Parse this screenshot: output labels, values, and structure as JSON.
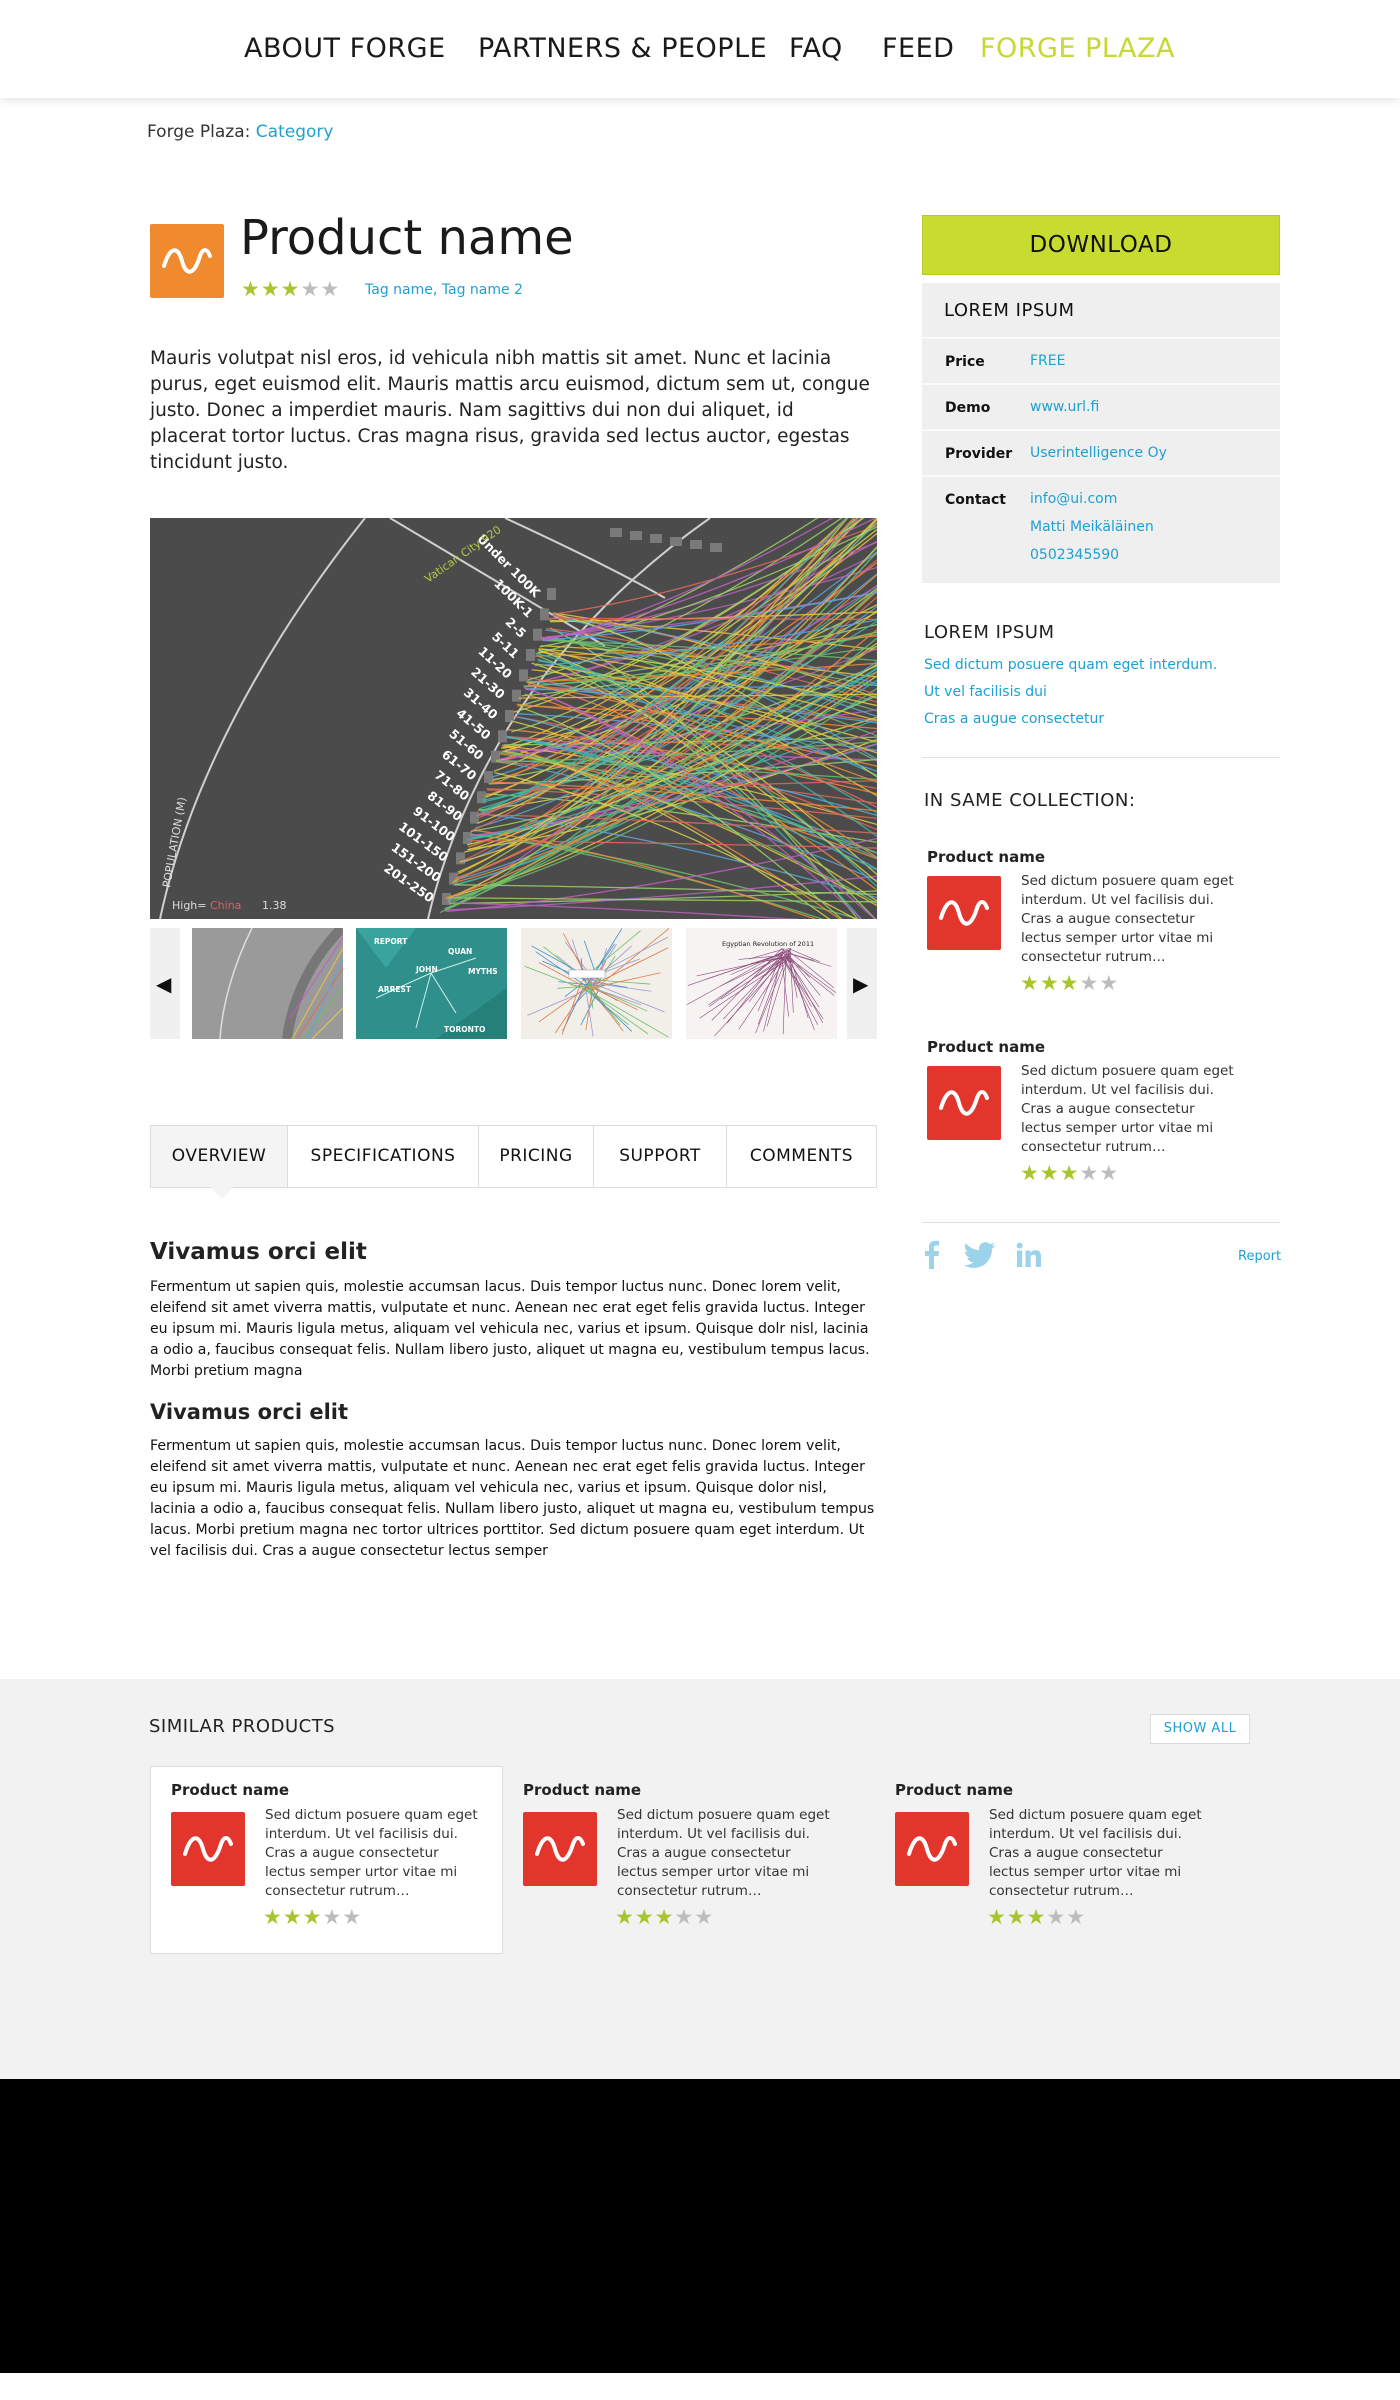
{
  "nav": {
    "items": [
      {
        "label": "ABOUT FORGE"
      },
      {
        "label": "PARTNERS & PEOPLE"
      },
      {
        "label": "FAQ"
      },
      {
        "label": "FEED"
      },
      {
        "label": "FORGE PLAZA"
      }
    ],
    "active_color": "#c5d931"
  },
  "breadcrumb": {
    "root": "Forge Plaza:",
    "current": "Category"
  },
  "product": {
    "title": "Product name",
    "rating": 3,
    "max_rating": 5,
    "tags": "Tag name, Tag name 2",
    "description": "Mauris volutpat nisl eros, id vehicula nibh mattis sit amet. Nunc et lacinia purus, eget euismod elit. Mauris mattis arcu euismod, dictum sem ut, congue justo. Donec a imperdiet mauris. Nam sagittivs dui non dui aliquet, id placerat tortor luctus. Cras magna risus, gravida sed lectus auctor, egestas tincidunt justo.",
    "logo_color": "#ef8a2e"
  },
  "gallery": {
    "main_labels": [
      "Under 100K",
      "100K-1",
      "2-5",
      "5-11",
      "11-20",
      "21-30",
      "31-40",
      "41-50",
      "51-60",
      "61-70",
      "71-80",
      "81-90",
      "91-100",
      "101-150",
      "151-200",
      "201-250"
    ],
    "axis_label": "POPULATION (M)",
    "legend_prefix": "High=",
    "legend_word": "China",
    "legend_value": "1.38",
    "city_label": "Vatican City 920",
    "thumbs": [
      "",
      "REPORT",
      "",
      ""
    ],
    "thumb_labels": {
      "t2": [
        "JOHN",
        "QUAN",
        "MYTHS",
        "ARREST",
        "TORONTO"
      ],
      "t4": "Egyptian Revolution of 2011"
    }
  },
  "tabs": [
    {
      "label": "OVERVIEW"
    },
    {
      "label": "SPECIFICATIONS"
    },
    {
      "label": "PRICING"
    },
    {
      "label": "SUPPORT"
    },
    {
      "label": "COMMENTS"
    }
  ],
  "sections": [
    {
      "heading": "Vivamus orci elit",
      "body": "Fermentum ut sapien quis, molestie accumsan lacus. Duis tempor luctus nunc. Donec lorem velit, eleifend sit amet viverra mattis, vulputate et nunc. Aenean nec erat eget felis gravida luctus. Integer eu ipsum mi. Mauris ligula metus, aliquam vel vehicula nec, varius et ipsum. Quisque dolr nisl, lacinia a odio a, faucibus consequat felis. Nullam libero justo, aliquet ut magna eu, vestibulum tempus lacus. Morbi pretium magna"
    },
    {
      "heading": "Vivamus orci elit",
      "body": "Fermentum ut sapien quis, molestie accumsan lacus. Duis tempor luctus nunc. Donec lorem velit, eleifend sit amet viverra mattis, vulputate et nunc. Aenean nec erat eget felis gravida luctus. Integer eu ipsum mi. Mauris ligula metus, aliquam vel vehicula nec, varius et ipsum. Quisque dolor nisl, lacinia a odio a, faucibus consequat felis. Nullam libero justo, aliquet ut magna eu, vestibulum tempus lacus. Morbi pretium magna nec tortor ultrices porttitor. Sed dictum posuere quam eget interdum. Ut vel facilisis dui. Cras a augue consectetur lectus semper"
    }
  ],
  "sidebar": {
    "download_label": "DOWNLOAD",
    "download_color": "#c8dc2f",
    "info_heading": "LOREM IPSUM",
    "info": {
      "price_label": "Price",
      "price": "FREE",
      "demo_label": "Demo",
      "demo": "www.url.fi",
      "provider_label": "Provider",
      "provider": "Userintelligence Oy",
      "contact_label": "Contact",
      "contact_email": "info@ui.com",
      "contact_name": "Matti Meikäläinen",
      "contact_phone": "0502345590"
    },
    "links_heading": "LOREM IPSUM",
    "links": [
      {
        "label": "Sed dictum posuere quam eget interdum."
      },
      {
        "label": "Ut vel facilisis dui"
      },
      {
        "label": "Cras a augue consectetur"
      }
    ],
    "collection_heading": "IN SAME COLLECTION:",
    "collection": [
      {
        "title": "Product name",
        "desc": "Sed dictum posuere quam eget interdum. Ut vel facilisis dui. Cras a augue consectetur lectus semper urtor vitae mi consectetur rutrum…",
        "rating": 3
      },
      {
        "title": "Product name",
        "desc": "Sed dictum posuere quam eget interdum. Ut vel facilisis dui. Cras a augue consectetur lectus semper urtor vitae mi consectetur rutrum…",
        "rating": 3
      }
    ],
    "social_icons": [
      "facebook-icon",
      "twitter-icon",
      "linkedin-icon"
    ],
    "social_color": "#9dd3ea",
    "report_label": "Report"
  },
  "similar": {
    "heading": "SIMILAR PRODUCTS",
    "show_all_label": "SHOW ALL",
    "items": [
      {
        "title": "Product name",
        "desc": "Sed dictum posuere quam eget interdum. Ut vel facilisis dui. Cras a augue consectetur lectus semper urtor vitae mi consectetur rutrum…",
        "rating": 3
      },
      {
        "title": "Product name",
        "desc": "Sed dictum posuere quam eget interdum. Ut vel facilisis dui. Cras a augue consectetur lectus semper urtor vitae mi consectetur rutrum…",
        "rating": 3
      },
      {
        "title": "Product name",
        "desc": "Sed dictum posuere quam eget interdum. Ut vel facilisis dui. Cras a augue consectetur lectus semper urtor vitae mi consectetur rutrum…",
        "rating": 3
      }
    ]
  },
  "colors": {
    "link": "#1ea0d2",
    "star_on": "#a7c62d",
    "star_off": "#bdbdbd",
    "product_logo_red": "#e2362d",
    "footer": "#000000"
  }
}
